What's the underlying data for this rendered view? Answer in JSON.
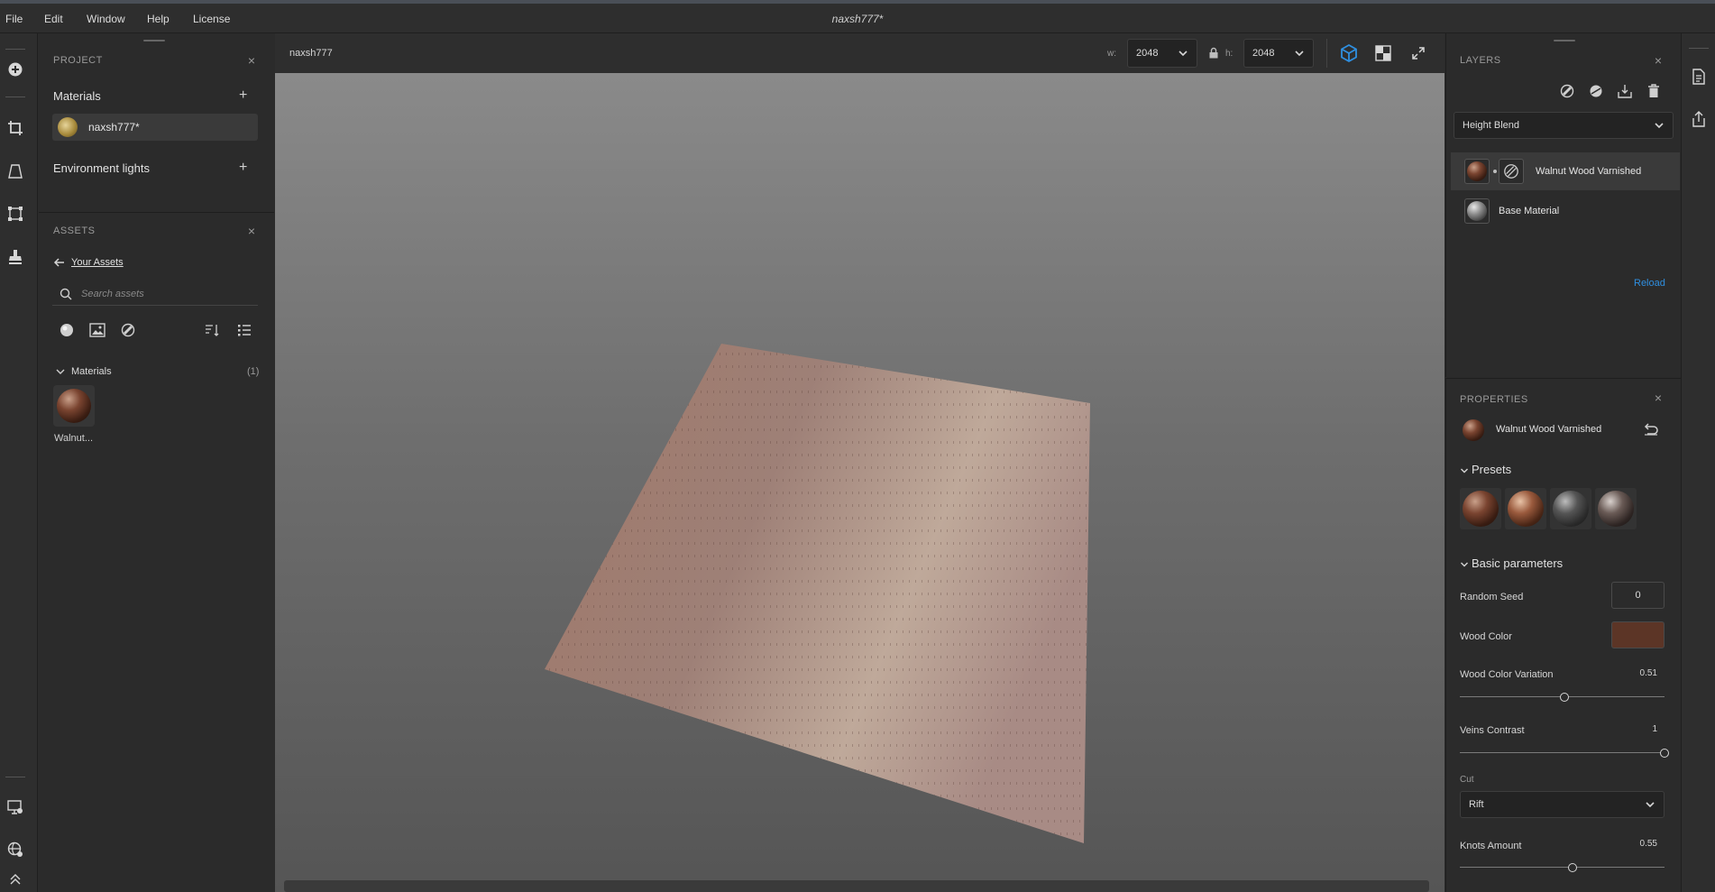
{
  "menu": {
    "items": [
      "File",
      "Edit",
      "Window",
      "Help",
      "License"
    ],
    "document_title": "naxsh777*"
  },
  "project": {
    "panel_title": "PROJECT",
    "materials_label": "Materials",
    "material_name": "naxsh777*",
    "env_label": "Environment lights"
  },
  "assets": {
    "panel_title": "ASSETS",
    "back_link": "Your Assets",
    "search_placeholder": "Search assets",
    "group_label": "Materials",
    "group_count": "(1)",
    "item_label": "Walnut..."
  },
  "viewport": {
    "tab_name": "naxsh777",
    "width_label": "w:",
    "width_value": "2048",
    "height_label": "h:",
    "height_value": "2048"
  },
  "layers": {
    "panel_title": "LAYERS",
    "blend_mode": "Height Blend",
    "items": [
      {
        "name": "Walnut Wood Varnished",
        "selected": true
      },
      {
        "name": "Base Material",
        "selected": false
      }
    ],
    "reload_label": "Reload"
  },
  "properties": {
    "panel_title": "PROPERTIES",
    "material_name": "Walnut Wood Varnished",
    "presets_label": "Presets",
    "basic_label": "Basic parameters",
    "random_seed_label": "Random Seed",
    "random_seed_value": "0",
    "wood_color_label": "Wood Color",
    "wood_color_swatch": "#5c3526",
    "wood_color_variation_label": "Wood Color Variation",
    "wood_color_variation_value": "0.51",
    "veins_contrast_label": "Veins Contrast",
    "veins_contrast_value": "1",
    "cut_label": "Cut",
    "cut_value": "Rift",
    "knots_amount_label": "Knots Amount",
    "knots_amount_value": "0.55"
  },
  "colors": {
    "accent": "#2f8fe0",
    "panel_bg": "#2b2b2b",
    "toolbar_bg": "#2e2e2e"
  }
}
